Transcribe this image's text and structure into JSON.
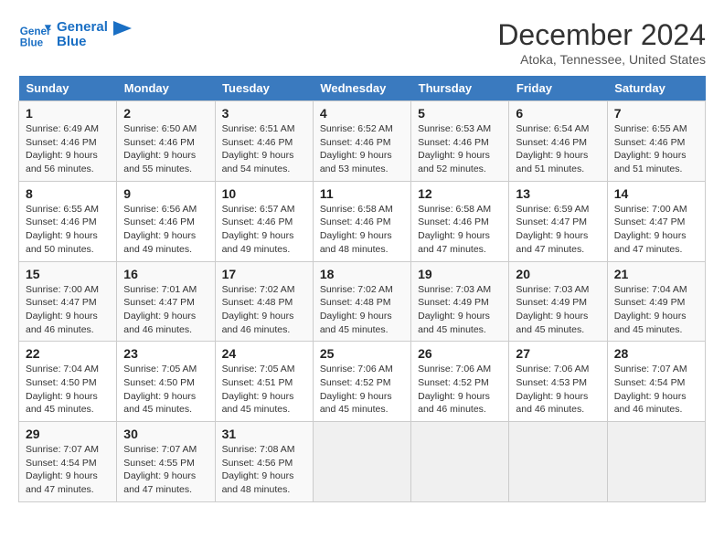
{
  "header": {
    "logo_line1": "General",
    "logo_line2": "Blue",
    "month": "December 2024",
    "location": "Atoka, Tennessee, United States"
  },
  "days_of_week": [
    "Sunday",
    "Monday",
    "Tuesday",
    "Wednesday",
    "Thursday",
    "Friday",
    "Saturday"
  ],
  "weeks": [
    [
      {
        "day": 1,
        "info": "Sunrise: 6:49 AM\nSunset: 4:46 PM\nDaylight: 9 hours\nand 56 minutes."
      },
      {
        "day": 2,
        "info": "Sunrise: 6:50 AM\nSunset: 4:46 PM\nDaylight: 9 hours\nand 55 minutes."
      },
      {
        "day": 3,
        "info": "Sunrise: 6:51 AM\nSunset: 4:46 PM\nDaylight: 9 hours\nand 54 minutes."
      },
      {
        "day": 4,
        "info": "Sunrise: 6:52 AM\nSunset: 4:46 PM\nDaylight: 9 hours\nand 53 minutes."
      },
      {
        "day": 5,
        "info": "Sunrise: 6:53 AM\nSunset: 4:46 PM\nDaylight: 9 hours\nand 52 minutes."
      },
      {
        "day": 6,
        "info": "Sunrise: 6:54 AM\nSunset: 4:46 PM\nDaylight: 9 hours\nand 51 minutes."
      },
      {
        "day": 7,
        "info": "Sunrise: 6:55 AM\nSunset: 4:46 PM\nDaylight: 9 hours\nand 51 minutes."
      }
    ],
    [
      {
        "day": 8,
        "info": "Sunrise: 6:55 AM\nSunset: 4:46 PM\nDaylight: 9 hours\nand 50 minutes."
      },
      {
        "day": 9,
        "info": "Sunrise: 6:56 AM\nSunset: 4:46 PM\nDaylight: 9 hours\nand 49 minutes."
      },
      {
        "day": 10,
        "info": "Sunrise: 6:57 AM\nSunset: 4:46 PM\nDaylight: 9 hours\nand 49 minutes."
      },
      {
        "day": 11,
        "info": "Sunrise: 6:58 AM\nSunset: 4:46 PM\nDaylight: 9 hours\nand 48 minutes."
      },
      {
        "day": 12,
        "info": "Sunrise: 6:58 AM\nSunset: 4:46 PM\nDaylight: 9 hours\nand 47 minutes."
      },
      {
        "day": 13,
        "info": "Sunrise: 6:59 AM\nSunset: 4:47 PM\nDaylight: 9 hours\nand 47 minutes."
      },
      {
        "day": 14,
        "info": "Sunrise: 7:00 AM\nSunset: 4:47 PM\nDaylight: 9 hours\nand 47 minutes."
      }
    ],
    [
      {
        "day": 15,
        "info": "Sunrise: 7:00 AM\nSunset: 4:47 PM\nDaylight: 9 hours\nand 46 minutes."
      },
      {
        "day": 16,
        "info": "Sunrise: 7:01 AM\nSunset: 4:47 PM\nDaylight: 9 hours\nand 46 minutes."
      },
      {
        "day": 17,
        "info": "Sunrise: 7:02 AM\nSunset: 4:48 PM\nDaylight: 9 hours\nand 46 minutes."
      },
      {
        "day": 18,
        "info": "Sunrise: 7:02 AM\nSunset: 4:48 PM\nDaylight: 9 hours\nand 45 minutes."
      },
      {
        "day": 19,
        "info": "Sunrise: 7:03 AM\nSunset: 4:49 PM\nDaylight: 9 hours\nand 45 minutes."
      },
      {
        "day": 20,
        "info": "Sunrise: 7:03 AM\nSunset: 4:49 PM\nDaylight: 9 hours\nand 45 minutes."
      },
      {
        "day": 21,
        "info": "Sunrise: 7:04 AM\nSunset: 4:49 PM\nDaylight: 9 hours\nand 45 minutes."
      }
    ],
    [
      {
        "day": 22,
        "info": "Sunrise: 7:04 AM\nSunset: 4:50 PM\nDaylight: 9 hours\nand 45 minutes."
      },
      {
        "day": 23,
        "info": "Sunrise: 7:05 AM\nSunset: 4:50 PM\nDaylight: 9 hours\nand 45 minutes."
      },
      {
        "day": 24,
        "info": "Sunrise: 7:05 AM\nSunset: 4:51 PM\nDaylight: 9 hours\nand 45 minutes."
      },
      {
        "day": 25,
        "info": "Sunrise: 7:06 AM\nSunset: 4:52 PM\nDaylight: 9 hours\nand 45 minutes."
      },
      {
        "day": 26,
        "info": "Sunrise: 7:06 AM\nSunset: 4:52 PM\nDaylight: 9 hours\nand 46 minutes."
      },
      {
        "day": 27,
        "info": "Sunrise: 7:06 AM\nSunset: 4:53 PM\nDaylight: 9 hours\nand 46 minutes."
      },
      {
        "day": 28,
        "info": "Sunrise: 7:07 AM\nSunset: 4:54 PM\nDaylight: 9 hours\nand 46 minutes."
      }
    ],
    [
      {
        "day": 29,
        "info": "Sunrise: 7:07 AM\nSunset: 4:54 PM\nDaylight: 9 hours\nand 47 minutes."
      },
      {
        "day": 30,
        "info": "Sunrise: 7:07 AM\nSunset: 4:55 PM\nDaylight: 9 hours\nand 47 minutes."
      },
      {
        "day": 31,
        "info": "Sunrise: 7:08 AM\nSunset: 4:56 PM\nDaylight: 9 hours\nand 48 minutes."
      },
      null,
      null,
      null,
      null
    ]
  ]
}
